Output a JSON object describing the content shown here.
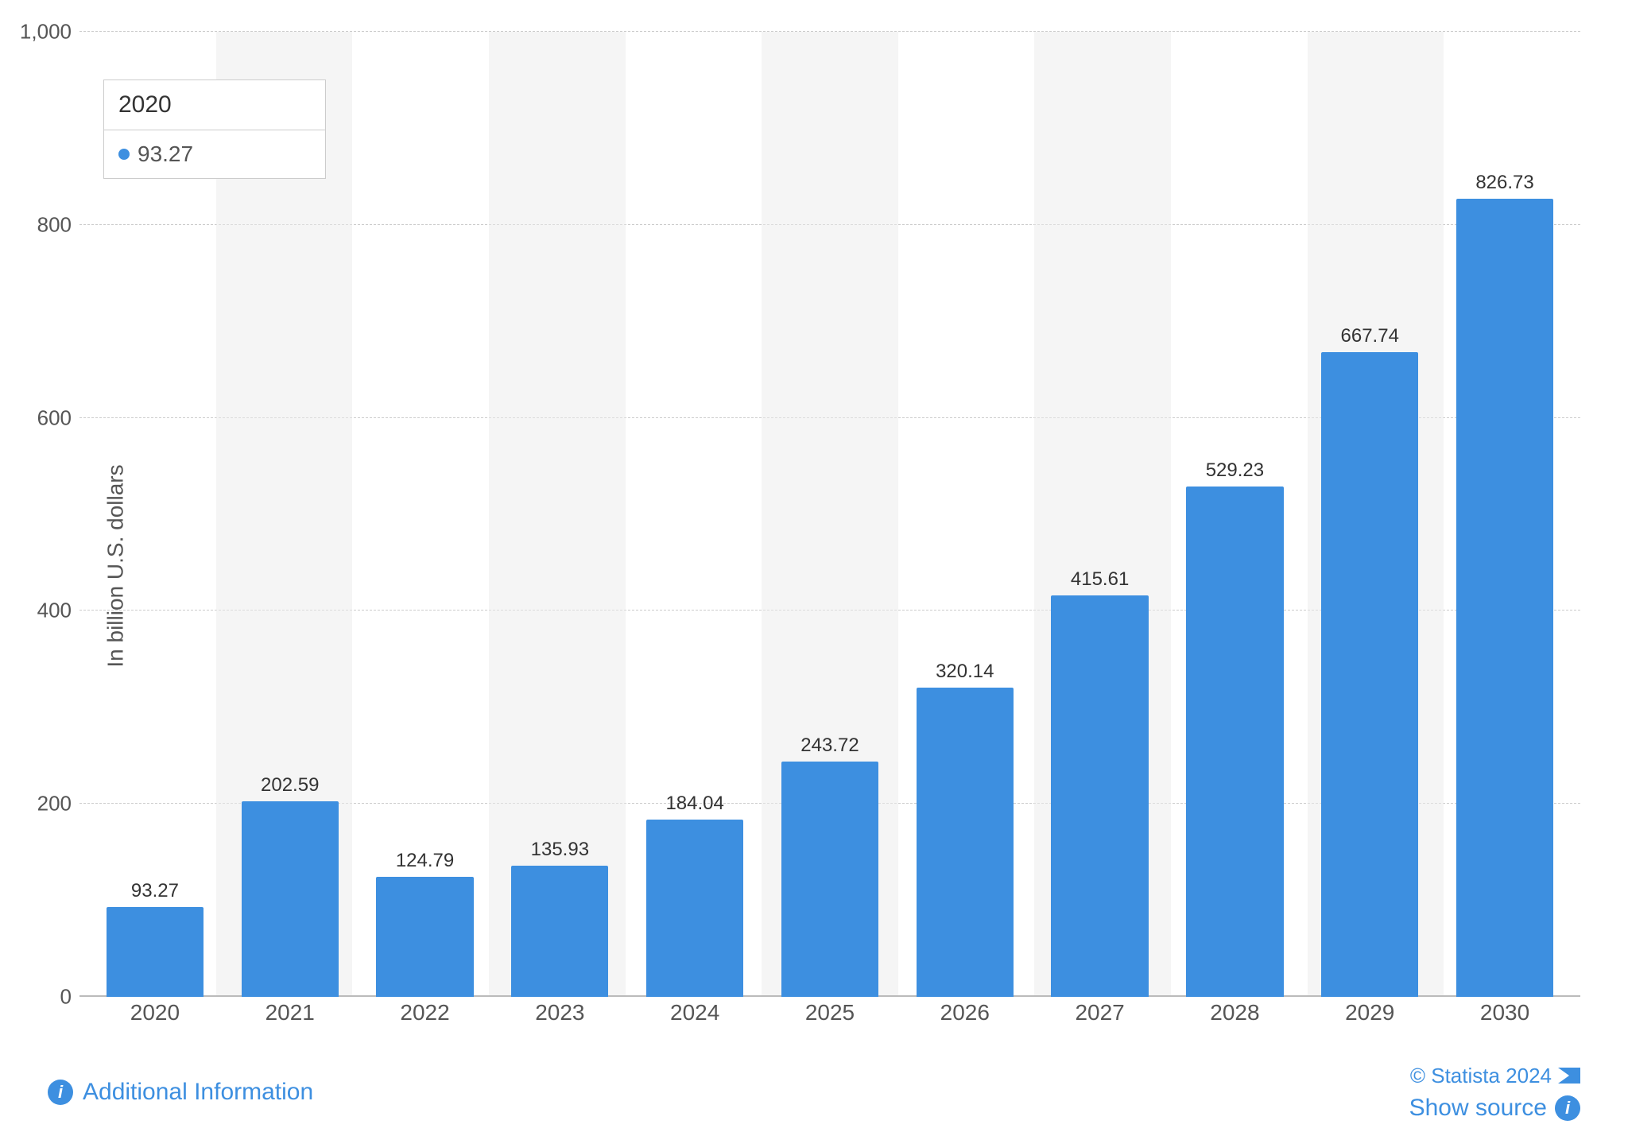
{
  "chart": {
    "y_axis_label": "In billion U.S. dollars",
    "y_max": 1000,
    "grid_lines": [
      {
        "value": 1000,
        "label": "1,000"
      },
      {
        "value": 800,
        "label": ""
      },
      {
        "value": 600,
        "label": "600"
      },
      {
        "value": 400,
        "label": "400"
      },
      {
        "value": 200,
        "label": "200"
      },
      {
        "value": 0,
        "label": "0"
      }
    ],
    "bars": [
      {
        "year": "2020",
        "value": 93.27
      },
      {
        "year": "2021",
        "value": 202.59
      },
      {
        "year": "2022",
        "value": 124.79
      },
      {
        "year": "2023",
        "value": 135.93
      },
      {
        "year": "2024",
        "value": 184.04
      },
      {
        "year": "2025",
        "value": 243.72
      },
      {
        "year": "2026",
        "value": 320.14
      },
      {
        "year": "2027",
        "value": 415.61
      },
      {
        "year": "2028",
        "value": 529.23
      },
      {
        "year": "2029",
        "value": 667.74
      },
      {
        "year": "2030",
        "value": 826.73
      }
    ],
    "tooltip": {
      "year": "2020",
      "value": "93.27"
    },
    "bar_color": "#3d8fe0",
    "shaded_cols": [
      1,
      3,
      5,
      7,
      9
    ]
  },
  "footer": {
    "additional_info_label": "Additional Information",
    "show_source_label": "Show source",
    "statista_credit": "© Statista 2024"
  }
}
